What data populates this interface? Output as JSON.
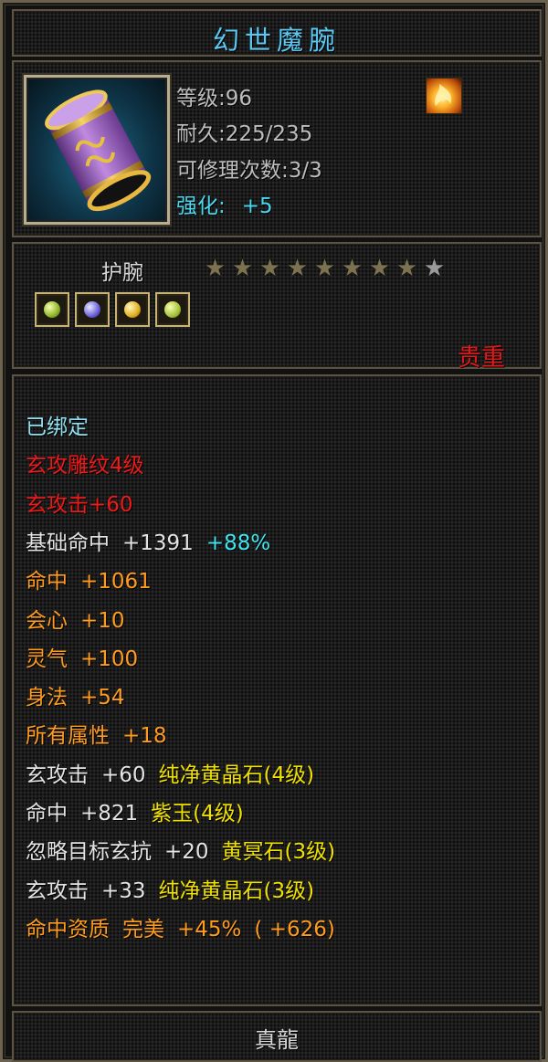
{
  "item": {
    "name": "幻世魔腕",
    "level_text": "等级:96",
    "durability_text": "耐久:225/235",
    "repair_text": "可修理次数:3/3",
    "enhance_label": "强化:",
    "enhance_value": "+5",
    "type": "护腕",
    "stars_filled": 8,
    "stars_total": 9,
    "precious": "贵重"
  },
  "icons": {
    "item": "bracer-icon",
    "fire": "flame-icon",
    "gems": [
      "green-gem-icon",
      "purple-gem-icon",
      "yellow-gem-icon",
      "green-gem-icon"
    ]
  },
  "attributes": [
    {
      "segments": [
        {
          "text": "已绑定",
          "color": "cyan"
        }
      ]
    },
    {
      "segments": [
        {
          "text": "玄攻雕纹4级",
          "color": "red"
        }
      ]
    },
    {
      "segments": [
        {
          "text": "玄攻击+60",
          "color": "red"
        }
      ]
    },
    {
      "segments": [
        {
          "text": "基础命中",
          "color": "white"
        },
        {
          "text": "+1391",
          "color": "white"
        },
        {
          "text": "+88%",
          "color": "ltcyan"
        }
      ]
    },
    {
      "segments": [
        {
          "text": "命中",
          "color": "orange"
        },
        {
          "text": "+1061",
          "color": "orange"
        }
      ]
    },
    {
      "segments": [
        {
          "text": "会心",
          "color": "orange"
        },
        {
          "text": "+10",
          "color": "orange"
        }
      ]
    },
    {
      "segments": [
        {
          "text": "灵气",
          "color": "orange"
        },
        {
          "text": "+100",
          "color": "orange"
        }
      ]
    },
    {
      "segments": [
        {
          "text": "身法",
          "color": "orange"
        },
        {
          "text": "+54",
          "color": "orange"
        }
      ]
    },
    {
      "segments": [
        {
          "text": "所有属性",
          "color": "orange"
        },
        {
          "text": "+18",
          "color": "orange"
        }
      ]
    },
    {
      "segments": [
        {
          "text": "玄攻击",
          "color": "white"
        },
        {
          "text": "+60",
          "color": "white"
        },
        {
          "text": "纯净黄晶石(4级)",
          "color": "yellow"
        }
      ]
    },
    {
      "segments": [
        {
          "text": "命中",
          "color": "white"
        },
        {
          "text": "+821",
          "color": "white"
        },
        {
          "text": "紫玉(4级)",
          "color": "yellow"
        }
      ]
    },
    {
      "segments": [
        {
          "text": "忽略目标玄抗",
          "color": "white"
        },
        {
          "text": "+20",
          "color": "white"
        },
        {
          "text": "黄冥石(3级)",
          "color": "yellow"
        }
      ]
    },
    {
      "segments": [
        {
          "text": "玄攻击",
          "color": "white"
        },
        {
          "text": "+33",
          "color": "white"
        },
        {
          "text": "纯净黄晶石(3级)",
          "color": "yellow"
        }
      ]
    },
    {
      "segments": [
        {
          "text": "命中资质",
          "color": "orange"
        },
        {
          "text": "完美",
          "color": "orange"
        },
        {
          "text": "+45%",
          "color": "orange"
        },
        {
          "text": "( +626)",
          "color": "orange"
        }
      ]
    }
  ],
  "footer": "真龍",
  "colors": {
    "title": "#5ec7ef",
    "frame": "#6b6250",
    "red": "#ee1a1a",
    "orange": "#ff9b1e",
    "yellow": "#f0e000",
    "cyan": "#8fe0f0"
  }
}
